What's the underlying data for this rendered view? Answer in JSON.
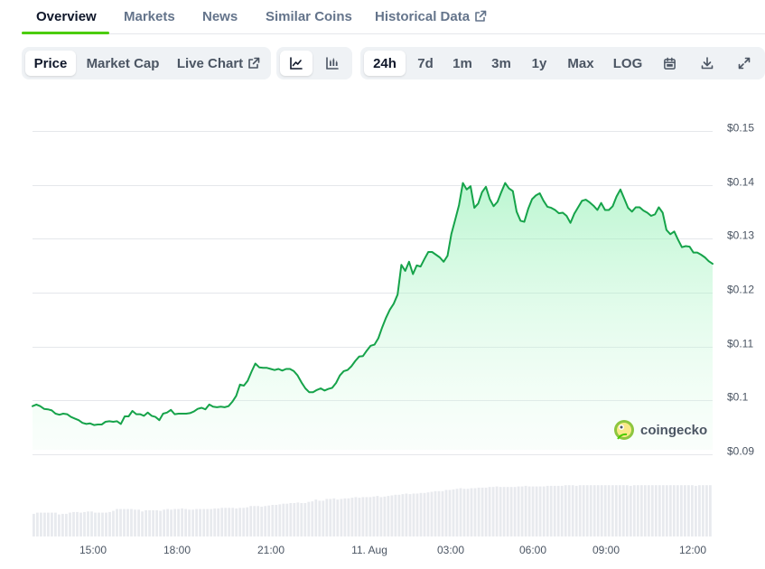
{
  "tabs": [
    {
      "label": "Overview"
    },
    {
      "label": "Markets"
    },
    {
      "label": "News"
    },
    {
      "label": "Similar Coins"
    },
    {
      "label": "Historical Data"
    }
  ],
  "toolbar": {
    "metric_buttons": [
      "Price",
      "Market Cap",
      "Live Chart"
    ],
    "chart_style_buttons": [
      "line-chart-icon",
      "candlestick-icon"
    ],
    "range_buttons": [
      "24h",
      "7d",
      "1m",
      "3m",
      "1y",
      "Max",
      "LOG"
    ],
    "tool_icons": [
      "calendar-icon",
      "download-icon",
      "expand-icon"
    ],
    "selected_metric": "Price",
    "selected_range": "24h",
    "selected_style": "line"
  },
  "watermark": "coingecko",
  "colors": {
    "accent": "#4bcc00",
    "line": "#16a34a",
    "area": "#86efac"
  },
  "chart_data": {
    "type": "area",
    "y_ticks": [
      "$0.15",
      "$0.14",
      "$0.13",
      "$0.12",
      "$0.11",
      "$0.1",
      "$0.09"
    ],
    "y_values": [
      0.15,
      0.14,
      0.13,
      0.12,
      0.11,
      0.1,
      0.09
    ],
    "ylim": [
      0.09,
      0.15
    ],
    "x_ticks": [
      "15:00",
      "18:00",
      "21:00",
      "11. Aug",
      "03:00",
      "06:00",
      "09:00",
      "12:00"
    ],
    "grid": true,
    "price_series": [
      0.0981,
      0.0984,
      0.0981,
      0.0976,
      0.0975,
      0.0973,
      0.0967,
      0.0965,
      0.0967,
      0.0966,
      0.0961,
      0.0958,
      0.0955,
      0.095,
      0.0948,
      0.0949,
      0.0946,
      0.0947,
      0.0947,
      0.0952,
      0.0953,
      0.0952,
      0.0953,
      0.0948,
      0.0962,
      0.0962,
      0.0972,
      0.0966,
      0.0966,
      0.0963,
      0.0969,
      0.0963,
      0.0961,
      0.0955,
      0.0967,
      0.0969,
      0.0974,
      0.0966,
      0.0967,
      0.0967,
      0.0967,
      0.0968,
      0.0971,
      0.0976,
      0.0978,
      0.0975,
      0.0984,
      0.098,
      0.0979,
      0.098,
      0.0979,
      0.0981,
      0.0989,
      0.1,
      0.1021,
      0.1019,
      0.1028,
      0.1045,
      0.106,
      0.1053,
      0.1052,
      0.1052,
      0.105,
      0.1048,
      0.105,
      0.1047,
      0.105,
      0.105,
      0.1046,
      0.1038,
      0.1025,
      0.1014,
      0.1007,
      0.1007,
      0.1011,
      0.1014,
      0.101,
      0.1013,
      0.1015,
      0.1024,
      0.1038,
      0.1046,
      0.1048,
      0.1055,
      0.1065,
      0.1073,
      0.1074,
      0.1084,
      0.1093,
      0.1095,
      0.1107,
      0.1127,
      0.1145,
      0.116,
      0.1171,
      0.1188,
      0.1243,
      0.1232,
      0.1249,
      0.1226,
      0.1242,
      0.124,
      0.1254,
      0.1267,
      0.1267,
      0.1262,
      0.1257,
      0.1249,
      0.126,
      0.13,
      0.1327,
      0.1354,
      0.1395,
      0.1383,
      0.1389,
      0.1349,
      0.1357,
      0.1378,
      0.1388,
      0.1365,
      0.1352,
      0.136,
      0.1378,
      0.1395,
      0.1385,
      0.138,
      0.1342,
      0.1325,
      0.1323,
      0.1347,
      0.1365,
      0.1372,
      0.1376,
      0.1362,
      0.1351,
      0.1349,
      0.1345,
      0.1339,
      0.134,
      0.1334,
      0.1321,
      0.1338,
      0.135,
      0.1362,
      0.1364,
      0.1359,
      0.1353,
      0.1345,
      0.1358,
      0.1345,
      0.1345,
      0.1352,
      0.137,
      0.1383,
      0.1366,
      0.1349,
      0.1342,
      0.135,
      0.135,
      0.1344,
      0.134,
      0.1334,
      0.1337,
      0.135,
      0.134,
      0.1308,
      0.13,
      0.1305,
      0.129,
      0.1276,
      0.1278,
      0.1277,
      0.1266,
      0.1266,
      0.1262,
      0.1257,
      0.125,
      0.1245
    ],
    "volume_series": [
      0.38,
      0.4,
      0.4,
      0.4,
      0.4,
      0.4,
      0.4,
      0.37,
      0.38,
      0.38,
      0.4,
      0.41,
      0.41,
      0.4,
      0.41,
      0.42,
      0.42,
      0.4,
      0.4,
      0.4,
      0.4,
      0.41,
      0.43,
      0.46,
      0.46,
      0.46,
      0.46,
      0.46,
      0.45,
      0.45,
      0.42,
      0.44,
      0.44,
      0.44,
      0.44,
      0.43,
      0.45,
      0.46,
      0.45,
      0.46,
      0.46,
      0.47,
      0.46,
      0.45,
      0.45,
      0.46,
      0.46,
      0.46,
      0.46,
      0.46,
      0.47,
      0.47,
      0.48,
      0.48,
      0.48,
      0.48,
      0.47,
      0.48,
      0.48,
      0.49,
      0.51,
      0.51,
      0.51,
      0.5,
      0.51,
      0.52,
      0.53,
      0.53,
      0.54,
      0.55,
      0.55,
      0.56,
      0.56,
      0.57,
      0.56,
      0.56,
      0.58,
      0.59,
      0.62,
      0.6,
      0.6,
      0.63,
      0.63,
      0.64,
      0.62,
      0.63,
      0.64,
      0.64,
      0.65,
      0.66,
      0.65,
      0.66,
      0.66,
      0.66,
      0.67,
      0.68,
      0.66,
      0.67,
      0.68,
      0.69,
      0.7,
      0.7,
      0.71,
      0.72,
      0.71,
      0.72,
      0.72,
      0.73,
      0.73,
      0.74,
      0.75,
      0.76,
      0.76,
      0.76,
      0.78,
      0.78,
      0.79,
      0.8,
      0.81,
      0.8,
      0.8,
      0.81,
      0.81,
      0.82,
      0.82,
      0.82,
      0.83,
      0.83,
      0.84,
      0.83,
      0.83,
      0.83,
      0.83,
      0.83,
      0.84,
      0.84,
      0.85,
      0.84,
      0.84,
      0.84,
      0.84,
      0.84,
      0.85,
      0.85,
      0.85,
      0.85,
      0.85,
      0.86,
      0.86,
      0.86,
      0.85,
      0.86,
      0.86,
      0.86,
      0.86,
      0.86,
      0.86,
      0.86,
      0.86,
      0.86,
      0.86,
      0.86,
      0.86,
      0.86,
      0.86,
      0.85,
      0.86,
      0.86,
      0.86,
      0.86,
      0.86,
      0.86,
      0.86,
      0.86,
      0.86,
      0.86,
      0.86,
      0.86,
      0.86,
      0.86,
      0.86,
      0.86,
      0.86,
      0.85,
      0.86,
      0.86,
      0.86,
      0.86
    ]
  }
}
